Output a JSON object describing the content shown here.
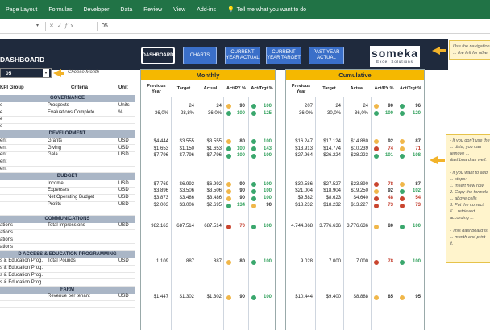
{
  "ribbon": {
    "tabs": [
      "Page Layout",
      "Formulas",
      "Developer",
      "Data",
      "Review",
      "View",
      "Add-ins"
    ],
    "tell_me": "Tell me what you want to do"
  },
  "formula_bar": {
    "cell_value": "05"
  },
  "header": {
    "title": "DASHBOARD",
    "nav": [
      {
        "label": "DASHBOARD",
        "active": true
      },
      {
        "label": "CHARTS",
        "active": false
      },
      {
        "label": "CURRENT YEAR ACTUAL",
        "active": false
      },
      {
        "label": "CURRENT YEAR TARGET",
        "active": false
      },
      {
        "label": "PAST YEAR ACTUAL",
        "active": false
      }
    ],
    "logo_main": "someka",
    "logo_sub": "Excel Solutions"
  },
  "notes": {
    "top": "Use the navigation ... the left for other ...",
    "side": "- If you don't use the ... data, you can remove ... dashboard as well.\n\n- If you want to add ... steps:\n1. Insert new row\n2. Copy the formula ... above cells\n3. Put the correct K... retrieved according ...\n\n- This dashboard is ... month and print it."
  },
  "month_selector": {
    "value": "05",
    "label": "Choose Month"
  },
  "left_headers": {
    "group": "KPI Group",
    "criteria": "Criteria",
    "unit": "Unit"
  },
  "rows": [
    {
      "type": "section",
      "label": "GOVERNANCE"
    },
    {
      "type": "kpi",
      "group": "e",
      "criteria": "Prospects",
      "unit": "Units",
      "m": [
        "",
        "24",
        "24",
        "90",
        "100"
      ],
      "md": [
        "orange",
        "green"
      ],
      "c": [
        "207",
        "24",
        "24",
        "90",
        "96"
      ],
      "cd": [
        "orange",
        "green"
      ]
    },
    {
      "type": "kpi",
      "group": "e",
      "criteria": "Evaluations Complete",
      "unit": "%",
      "m": [
        "36,0%",
        "28,8%",
        "36,0%",
        "100",
        "125"
      ],
      "md": [
        "green",
        "green"
      ],
      "c": [
        "36,0%",
        "30,0%",
        "36,0%",
        "100",
        "120"
      ],
      "cd": [
        "green",
        "green"
      ]
    },
    {
      "type": "empty",
      "group": "e"
    },
    {
      "type": "empty",
      "group": "e"
    },
    {
      "type": "section",
      "label": "DEVELOPMENT"
    },
    {
      "type": "kpi",
      "group": "ent",
      "criteria": "Grants",
      "unit": "USD",
      "m": [
        "$4.444",
        "$3.555",
        "$3.555",
        "80",
        "100"
      ],
      "md": [
        "orange",
        "green"
      ],
      "c": [
        "$16.247",
        "$17.124",
        "$14.880",
        "92",
        "87"
      ],
      "cd": [
        "orange",
        "orange"
      ]
    },
    {
      "type": "kpi",
      "group": "ent",
      "criteria": "Giving",
      "unit": "USD",
      "m": [
        "$1.653",
        "$1.150",
        "$1.653",
        "100",
        "143"
      ],
      "md": [
        "green",
        "green"
      ],
      "c": [
        "$13.913",
        "$14.774",
        "$10.239",
        "74",
        "71"
      ],
      "cd": [
        "red",
        "orange"
      ]
    },
    {
      "type": "kpi",
      "group": "ent",
      "criteria": "Gala",
      "unit": "USD",
      "m": [
        "$7.796",
        "$7.796",
        "$7.796",
        "100",
        "100"
      ],
      "md": [
        "green",
        "green"
      ],
      "c": [
        "$27.964",
        "$26.224",
        "$28.223",
        "101",
        "108"
      ],
      "cd": [
        "green",
        "green"
      ]
    },
    {
      "type": "empty",
      "group": "ent"
    },
    {
      "type": "empty",
      "group": "ent"
    },
    {
      "type": "section",
      "label": "BUDGET"
    },
    {
      "type": "kpi",
      "group": "",
      "criteria": "Income",
      "unit": "USD",
      "m": [
        "$7.769",
        "$6.992",
        "$6.992",
        "90",
        "100"
      ],
      "md": [
        "orange",
        "green"
      ],
      "c": [
        "$30.586",
        "$27.527",
        "$23.890",
        "78",
        "87"
      ],
      "cd": [
        "red",
        "orange"
      ]
    },
    {
      "type": "kpi",
      "group": "",
      "criteria": "Expenses",
      "unit": "USD",
      "m": [
        "$3.896",
        "$3.506",
        "$3.506",
        "90",
        "100"
      ],
      "md": [
        "orange",
        "green"
      ],
      "c": [
        "$21.004",
        "$18.904",
        "$19.250",
        "92",
        "102"
      ],
      "cd": [
        "orange",
        "green"
      ]
    },
    {
      "type": "kpi",
      "group": "",
      "criteria": "Net Operating Budget",
      "unit": "USD",
      "m": [
        "$3.873",
        "$3.486",
        "$3.486",
        "90",
        "100"
      ],
      "md": [
        "orange",
        "green"
      ],
      "c": [
        "$9.582",
        "$8.623",
        "$4.640",
        "48",
        "54"
      ],
      "cd": [
        "red",
        "red"
      ]
    },
    {
      "type": "kpi",
      "group": "",
      "criteria": "Profits",
      "unit": "USD",
      "m": [
        "$2.003",
        "$3.006",
        "$2.695",
        "134",
        "90"
      ],
      "md": [
        "green",
        "orange"
      ],
      "c": [
        "$18.232",
        "$18.232",
        "$13.227",
        "73",
        "73"
      ],
      "cd": [
        "red",
        "red"
      ]
    },
    {
      "type": "empty",
      "group": ""
    },
    {
      "type": "section",
      "label": "COMMUNICATIONS"
    },
    {
      "type": "kpi",
      "group": "ations",
      "criteria": "Total Impressions",
      "unit": "USD",
      "m": [
        "982.163",
        "687.514",
        "687.514",
        "70",
        "100"
      ],
      "md": [
        "red",
        "green"
      ],
      "c": [
        "4.744.868",
        "3.776.636",
        "3.776.636",
        "80",
        "100"
      ],
      "cd": [
        "orange",
        "green"
      ]
    },
    {
      "type": "empty",
      "group": "ations"
    },
    {
      "type": "empty",
      "group": "ations"
    },
    {
      "type": "empty",
      "group": "ations"
    },
    {
      "type": "section",
      "label": "D ACCESS & EDUCATION PROGRAMMING"
    },
    {
      "type": "kpi",
      "group": "s & Education Prog.",
      "criteria": "Total Pounds",
      "unit": "USD",
      "m": [
        "1.109",
        "887",
        "887",
        "80",
        "100"
      ],
      "md": [
        "orange",
        "green"
      ],
      "c": [
        "9.028",
        "7.000",
        "7.000",
        "78",
        "100"
      ],
      "cd": [
        "red",
        "green"
      ]
    },
    {
      "type": "empty",
      "group": "s & Education Prog."
    },
    {
      "type": "empty",
      "group": "s & Education Prog."
    },
    {
      "type": "empty",
      "group": "s & Education Prog."
    },
    {
      "type": "section",
      "label": "FARM"
    },
    {
      "type": "kpi",
      "group": "",
      "criteria": "Revenue per tenant",
      "unit": "USD",
      "m": [
        "$1.447",
        "$1.302",
        "$1.302",
        "90",
        "100"
      ],
      "md": [
        "orange",
        "green"
      ],
      "c": [
        "$10.444",
        "$9.400",
        "$8.888",
        "85",
        "95"
      ],
      "cd": [
        "orange",
        "orange"
      ]
    },
    {
      "type": "empty",
      "group": ""
    }
  ],
  "monthly": {
    "title": "Monthly",
    "cols": [
      "Previous Year",
      "Target",
      "Actual",
      "Act/PY %",
      "Act/Trgt %"
    ]
  },
  "cumulative": {
    "title": "Cumulative",
    "cols": [
      "Previous Year",
      "Target",
      "Actual",
      "Act/PY %",
      "Act/Trgt %"
    ]
  },
  "colors": {
    "green": "#3aa76d",
    "orange": "#f0b74a",
    "red": "#c9452f",
    "pct_green": "#2f9f5a",
    "pct_red": "#c23a2a",
    "pct_orange": "#333333"
  }
}
